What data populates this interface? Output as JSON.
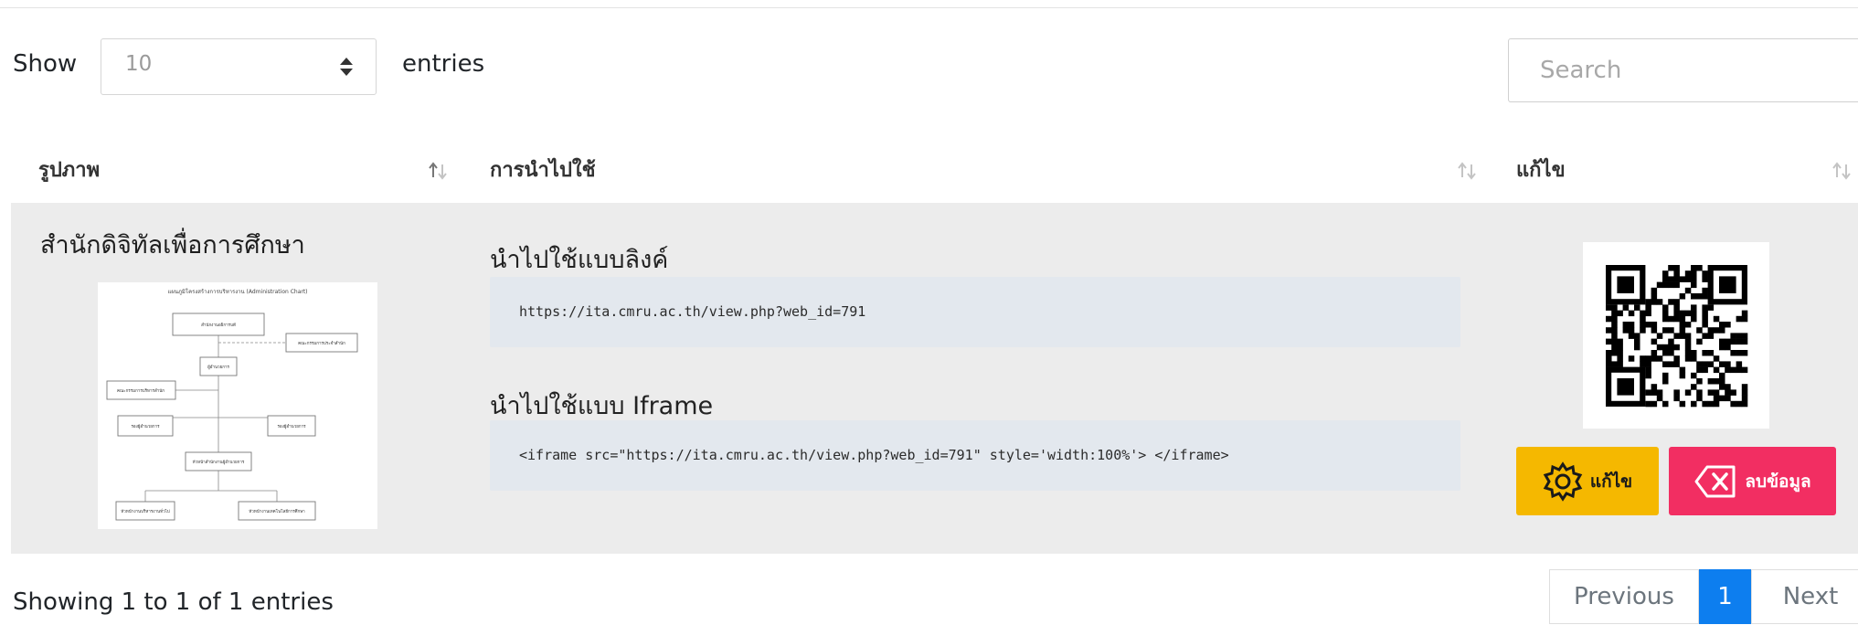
{
  "length_menu": {
    "show_label": "Show",
    "selected": "10",
    "entries_label": "entries"
  },
  "search": {
    "placeholder": "Search"
  },
  "table": {
    "headers": [
      "รูปภาพ",
      "การนำไปใช้",
      "แก้ไข"
    ],
    "rows": [
      {
        "name": "สำนักดิจิทัลเพื่อการศึกษา",
        "org_chart": {
          "title": "แผนภูมิโครงสร้างการบริหารงาน (Administration Chart)",
          "boxes": [
            "สำนักงานอธิการบดี",
            "คณะกรรมการประจำสำนัก",
            "ผู้อำนวยการ",
            "คณะกรรมการบริหารสำนัก",
            "รองผู้อำนวยการ",
            "รองผู้อำนวยการ",
            "หัวหน้าสำนักงานผู้อำนวยการ",
            "หัวหน้างานบริหารงานทั่วไป",
            "หัวหน้างานเทคโนโลยีการศึกษา"
          ]
        },
        "link_title": "นำไปใช้แบบลิงค์",
        "link": "https://ita.cmru.ac.th/view.php?web_id=791",
        "iframe_title": "นำไปใช้แบบ Iframe",
        "iframe_code": "<iframe src=\"https://ita.cmru.ac.th/view.php?web_id=791\" style='width:100%'> </iframe>",
        "edit_label": "แก้ไข",
        "delete_label": "ลบข้อมูล"
      }
    ]
  },
  "footer": {
    "info": "Showing 1 to 1 of 1 entries",
    "previous": "Previous",
    "current_page": "1",
    "next": "Next"
  },
  "colors": {
    "edit_button": "#f5b800",
    "delete_button": "#f22e62",
    "active_page": "#0d7eef",
    "row_background": "#ececec",
    "code_background": "#e3e8ee"
  },
  "icons": [
    "sort-icon",
    "select-arrows-icon",
    "qr-code-icon",
    "gear-icon",
    "backspace-x-icon"
  ]
}
